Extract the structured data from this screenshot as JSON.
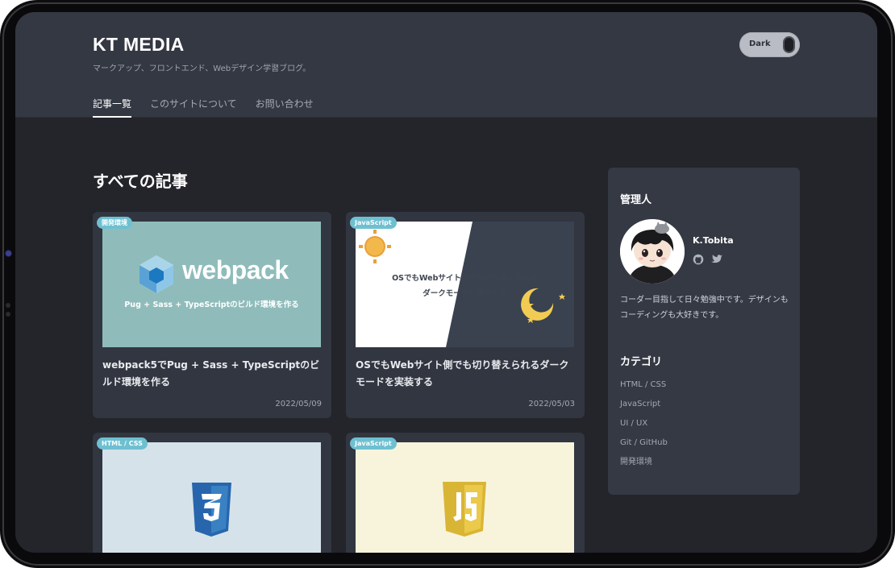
{
  "site": {
    "title": "KT MEDIA",
    "tagline": "マークアップ、フロントエンド、Webデザイン学習ブログ。"
  },
  "theme_toggle": {
    "label": "Dark",
    "state": "dark"
  },
  "nav": {
    "items": [
      {
        "label": "記事一覧",
        "active": true
      },
      {
        "label": "このサイトについて",
        "active": false
      },
      {
        "label": "お問い合わせ",
        "active": false
      }
    ]
  },
  "main": {
    "heading": "すべての記事"
  },
  "articles": [
    {
      "tag": "開発環境",
      "thumb_logo": "webpack",
      "thumb_caption": "Pug + Sass + TypeScriptのビルド環境を作る",
      "title": "webpack5でPug + Sass + TypeScriptのビルド環境を作る",
      "date": "2022/05/09",
      "thumb_icon": "webpack-cube-icon"
    },
    {
      "tag": "JavaScript",
      "thumb_line1": "OSでもWebサイト側でも切り替えられる",
      "thumb_line2": "ダークモードを実装する",
      "title": "OSでもWebサイト側でも切り替えられるダークモードを実装する",
      "date": "2022/05/03",
      "thumb_icon": "sun-moon-icon"
    },
    {
      "tag": "HTML / CSS",
      "thumb_icon": "css3-icon"
    },
    {
      "tag": "JavaScript",
      "thumb_icon": "js-icon"
    }
  ],
  "sidebar": {
    "admin_heading": "管理人",
    "author_name": "K.Tobita",
    "social": [
      "github-icon",
      "twitter-icon"
    ],
    "bio": "コーダー目指して日々勉強中です。デザインもコーディングも大好きです。",
    "category_heading": "カテゴリ",
    "categories": [
      "HTML / CSS",
      "JavaScript",
      "UI / UX",
      "Git / GitHub",
      "開発環境"
    ]
  },
  "colors": {
    "background": "#23252b",
    "header": "#343842",
    "card": "#323640",
    "tag": "#6ec0d1",
    "webpack_thumb": "#8fbcbb",
    "css_thumb": "#d6e2ea",
    "js_thumb": "#f8f4dc"
  }
}
